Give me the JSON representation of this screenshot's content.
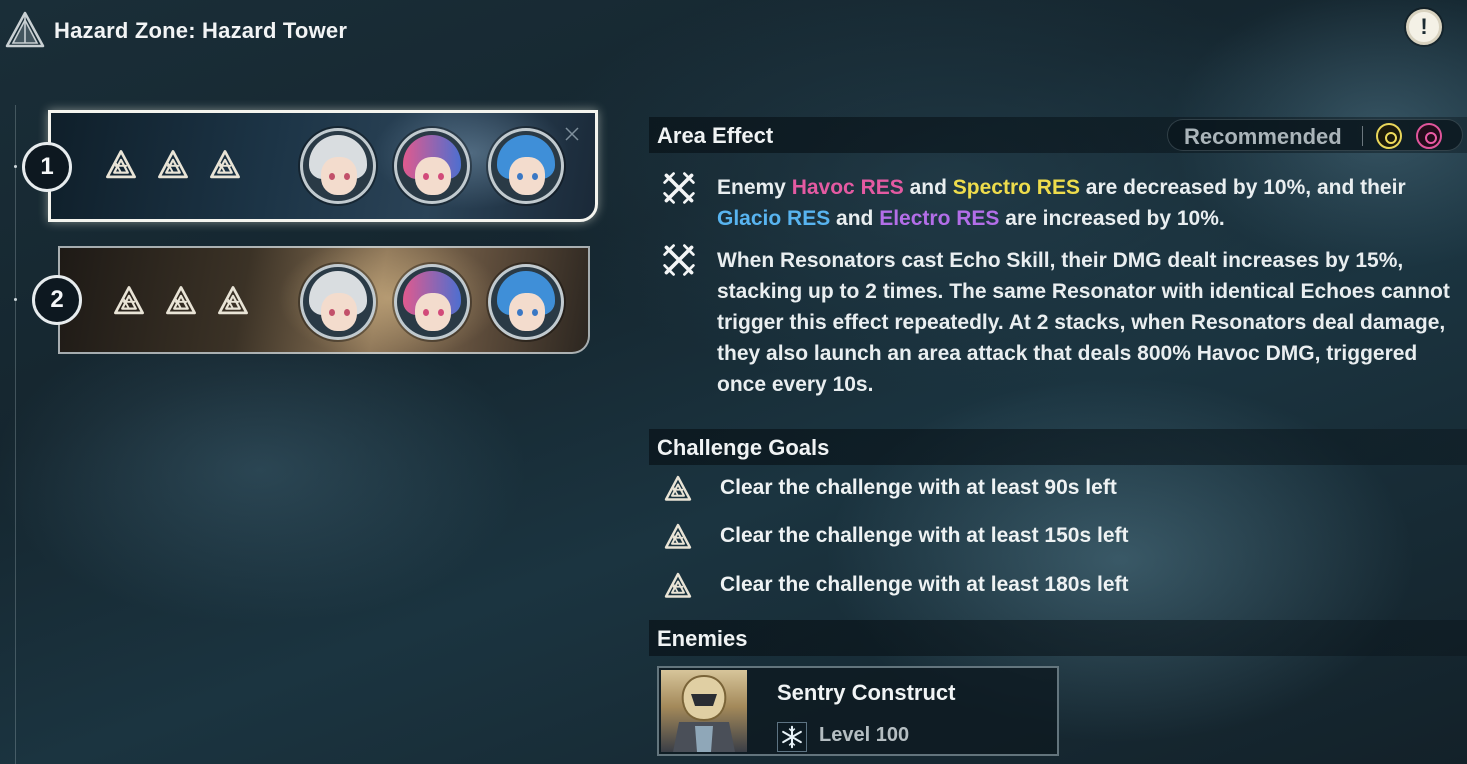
{
  "header": {
    "title": "Hazard Zone: Hazard Tower",
    "info_icon": "exclamation-icon",
    "info_symbol": "!"
  },
  "stages": [
    {
      "number": "1",
      "selected": true,
      "goal_marks": [
        "tri-goal-icon",
        "tri-goal-icon",
        "tri-goal-icon"
      ],
      "team": [
        "resonator-white-hair",
        "resonator-pink-hair",
        "resonator-blue-hair"
      ]
    },
    {
      "number": "2",
      "selected": false,
      "goal_marks": [
        "tri-goal-icon",
        "tri-goal-icon",
        "tri-goal-icon"
      ],
      "team": [
        "resonator-white-hair",
        "resonator-pink-hair",
        "resonator-blue-hair"
      ]
    }
  ],
  "area_effect": {
    "heading": "Area Effect",
    "recommended_label": "Recommended",
    "recommended_elements": [
      "Spectro",
      "Havoc"
    ],
    "effects": [
      {
        "parts": [
          {
            "text": "Enemy ",
            "kw": ""
          },
          {
            "text": "Havoc RES",
            "kw": "havoc"
          },
          {
            "text": " and ",
            "kw": ""
          },
          {
            "text": "Spectro RES",
            "kw": "spectro"
          },
          {
            "text": " are decreased by 10%, and their ",
            "kw": ""
          },
          {
            "text": "Glacio RES",
            "kw": "glacio"
          },
          {
            "text": " and ",
            "kw": ""
          },
          {
            "text": "Electro RES",
            "kw": "electro"
          },
          {
            "text": " are increased by 10%.",
            "kw": ""
          }
        ]
      },
      {
        "text": "When Resonators cast Echo Skill, their DMG dealt increases by 15%, stacking up to 2 times. The same Resonator with identical Echoes cannot trigger this effect repeatedly. At 2 stacks, when Resonators deal damage, they also launch an area attack that deals 800% Havoc DMG, triggered once every 10s."
      }
    ]
  },
  "challenge_goals": {
    "heading": "Challenge Goals",
    "items": [
      "Clear the challenge with at least 90s left",
      "Clear the challenge with at least 150s left",
      "Clear the challenge with at least 180s left"
    ]
  },
  "enemies": {
    "heading": "Enemies",
    "list": [
      {
        "name": "Sentry Construct",
        "level": "Level 100",
        "element": "Glacio",
        "element_icon": "snowflake-icon"
      }
    ]
  },
  "colors": {
    "havoc": "#e45aa2",
    "spectro": "#eedc4c",
    "glacio": "#58b4f0",
    "electro": "#b36ee8"
  }
}
